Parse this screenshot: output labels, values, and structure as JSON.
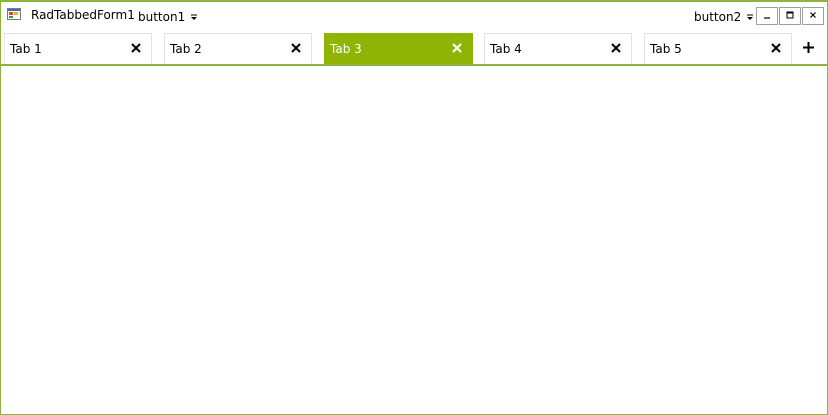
{
  "window": {
    "title": "RadTabbedForm1",
    "accent_color": "#8fb404",
    "border_color": "#8fb43a"
  },
  "titlebar": {
    "app_icon": "windows-form-icon",
    "left_button": {
      "label": "button1",
      "icon": "dropdown-arrow-icon"
    },
    "right_button": {
      "label": "button2",
      "icon": "dropdown-arrow-icon"
    },
    "system_buttons": [
      "minimize-icon",
      "maximize-icon",
      "close-icon"
    ]
  },
  "tabs": [
    {
      "label": "Tab 1",
      "active": false
    },
    {
      "label": "Tab 2",
      "active": false
    },
    {
      "label": "Tab 3",
      "active": true
    },
    {
      "label": "Tab 4",
      "active": false
    },
    {
      "label": "Tab 5",
      "active": false
    }
  ],
  "add_tab_icon": "plus-icon"
}
